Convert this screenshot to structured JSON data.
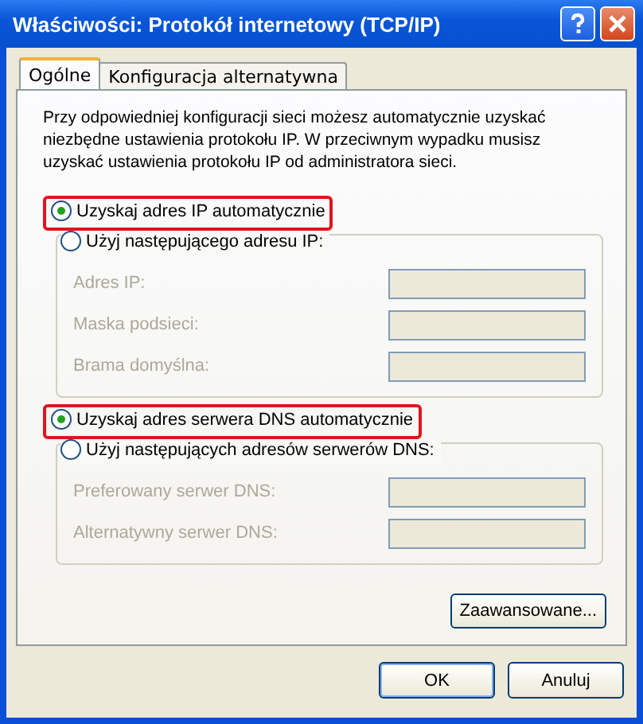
{
  "window": {
    "title": "Właściwości: Protokół internetowy (TCP/IP)"
  },
  "tabs": [
    {
      "label": "Ogólne",
      "selected": true
    },
    {
      "label": "Konfiguracja alternatywna",
      "selected": false
    }
  ],
  "description": "Przy odpowiedniej konfiguracji sieci możesz automatycznie uzyskać niezbędne ustawienia protokołu IP. W przeciwnym wypadku musisz uzyskać ustawienia protokołu IP od administratora sieci.",
  "sections": [
    {
      "auto_option": {
        "label": "Uzyskaj adres IP automatycznie",
        "selected": true,
        "highlighted": true
      },
      "manual_option": {
        "label": "Użyj następującego adresu IP:",
        "selected": false,
        "highlighted": false
      },
      "fields": [
        {
          "label": "Adres IP:",
          "disabled": true
        },
        {
          "label": "Maska podsieci:",
          "disabled": true
        },
        {
          "label": "Brama domyślna:",
          "disabled": true
        }
      ]
    },
    {
      "auto_option": {
        "label": "Uzyskaj adres serwera DNS automatycznie",
        "selected": true,
        "highlighted": true
      },
      "manual_option": {
        "label": "Użyj następujących adresów serwerów DNS:",
        "selected": false,
        "highlighted": false
      },
      "fields": [
        {
          "label": "Preferowany serwer DNS:",
          "disabled": true
        },
        {
          "label": "Alternatywny serwer DNS:",
          "disabled": true
        }
      ]
    }
  ],
  "advanced_button": "Zaawansowane...",
  "buttons": [
    "OK",
    "Anuluj"
  ]
}
